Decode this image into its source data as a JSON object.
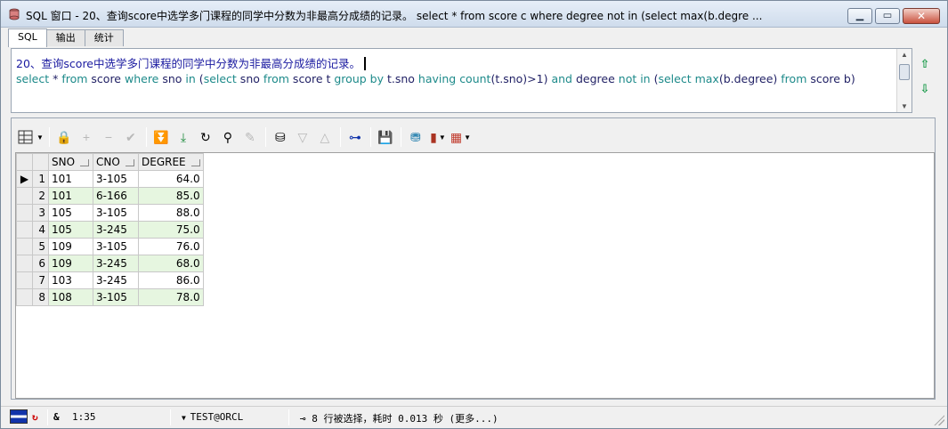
{
  "window": {
    "title": "SQL 窗口 - 20、查询score中选学多门课程的同学中分数为非最高分成绩的记录。 select * from score c where degree not in (select max(b.degre ..."
  },
  "tabs": [
    {
      "label": "SQL",
      "active": true
    },
    {
      "label": "输出",
      "active": false
    },
    {
      "label": "统计",
      "active": false
    }
  ],
  "editor": {
    "comment_line": "20、查询score中选学多门课程的同学中分数为非最高分成绩的记录。",
    "sql_tokens": [
      {
        "t": "select",
        "k": "kw"
      },
      {
        "t": " * ",
        "k": "id"
      },
      {
        "t": "from",
        "k": "kw"
      },
      {
        "t": " score ",
        "k": "id"
      },
      {
        "t": "where",
        "k": "kw"
      },
      {
        "t": " sno ",
        "k": "id"
      },
      {
        "t": "in",
        "k": "kw"
      },
      {
        "t": " (",
        "k": "id"
      },
      {
        "t": "select",
        "k": "kw"
      },
      {
        "t": " sno ",
        "k": "id"
      },
      {
        "t": "from",
        "k": "kw"
      },
      {
        "t": " score t ",
        "k": "id"
      },
      {
        "t": "group by",
        "k": "kw"
      },
      {
        "t": " t.sno ",
        "k": "id"
      },
      {
        "t": "having",
        "k": "kw"
      },
      {
        "t": " ",
        "k": "id"
      },
      {
        "t": "count",
        "k": "kw"
      },
      {
        "t": "(t.sno)>1) ",
        "k": "id"
      },
      {
        "t": "and",
        "k": "kw"
      },
      {
        "t": " degree ",
        "k": "id"
      },
      {
        "t": "not in",
        "k": "kw"
      },
      {
        "t": " (",
        "k": "id"
      },
      {
        "t": "select",
        "k": "kw"
      },
      {
        "t": " ",
        "k": "id"
      },
      {
        "t": "max",
        "k": "kw"
      },
      {
        "t": "(b.degree) ",
        "k": "id"
      },
      {
        "t": "from",
        "k": "kw"
      },
      {
        "t": " score b)",
        "k": "id"
      }
    ]
  },
  "grid": {
    "columns": [
      "SNO",
      "CNO",
      "DEGREE"
    ],
    "rows": [
      {
        "n": "1",
        "sno": "101",
        "cno": "3-105",
        "degree": "64.0"
      },
      {
        "n": "2",
        "sno": "101",
        "cno": "6-166",
        "degree": "85.0"
      },
      {
        "n": "3",
        "sno": "105",
        "cno": "3-105",
        "degree": "88.0"
      },
      {
        "n": "4",
        "sno": "105",
        "cno": "3-245",
        "degree": "75.0"
      },
      {
        "n": "5",
        "sno": "109",
        "cno": "3-105",
        "degree": "76.0"
      },
      {
        "n": "6",
        "sno": "109",
        "cno": "3-245",
        "degree": "68.0"
      },
      {
        "n": "7",
        "sno": "103",
        "cno": "3-245",
        "degree": "86.0"
      },
      {
        "n": "8",
        "sno": "108",
        "cno": "3-105",
        "degree": "78.0"
      }
    ]
  },
  "status": {
    "position": "1:35",
    "connection": "TEST@ORCL",
    "message": "8 行被选择，耗时 0.013 秒 (更多...)"
  }
}
